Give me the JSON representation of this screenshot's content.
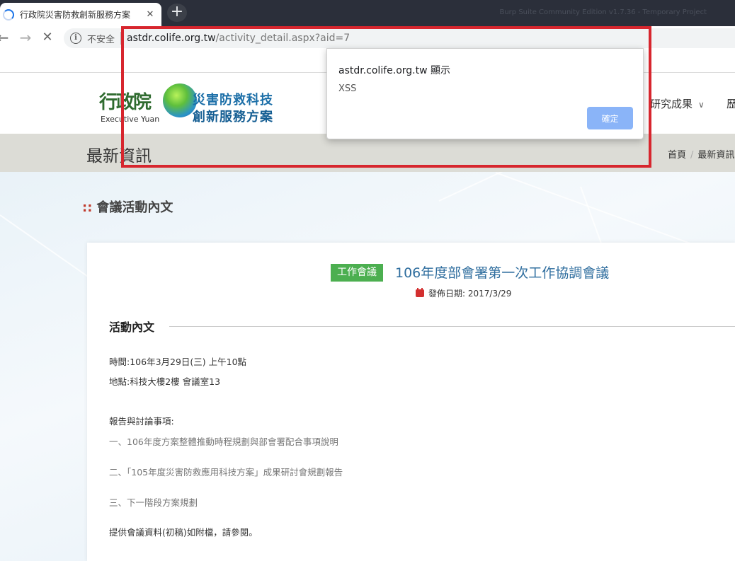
{
  "browser": {
    "tab_title": "行政院災害防救創新服務方案",
    "tab_close": "✕",
    "newtab": "+",
    "background_window_title": "Burp Suite Community Edition v1.7.36 - Temporary Project",
    "back": "←",
    "forward": "→",
    "reload": "✕",
    "info_glyph": "i",
    "insecure_label": "不安全",
    "url_host": "astdr.colife.org.tw",
    "url_path": "/activity_detail.aspx?aid=7"
  },
  "alert": {
    "title": "astdr.colife.org.tw 顯示",
    "message": "XSS",
    "ok_label": "確定"
  },
  "site": {
    "logo_yuan": "行政院",
    "logo_en": "Executive Yuan",
    "logo_line1": "災害防救科技",
    "logo_line2": "創新服務方案",
    "menu": [
      {
        "label": "研究成果",
        "chevron": "∨"
      },
      {
        "label": "歷"
      }
    ],
    "band_title": "最新資訊",
    "breadcrumb": [
      "首頁",
      "最新資訊"
    ],
    "breadcrumb_sep": "/"
  },
  "section": {
    "dots": "::",
    "title": "會議活動內文"
  },
  "article": {
    "badge": "工作會議",
    "title": "106年度部會署第一次工作協調會議",
    "date_label": "發佈日期:",
    "date": "2017/3/29",
    "subhead": "活動內文",
    "lines": [
      "時間:106年3月29日(三) 上午10點",
      "地點:科技大樓2樓 會議室13",
      "報告與討論事項:",
      "一、106年度方案整體推動時程規劃與部會署配合事項說明",
      "二、「105年度災害防救應用科技方案」成果研討會規劃報告",
      "三、下一階段方案規劃",
      "提供會議資料(初稿)如附檔，請參閱。"
    ]
  },
  "colors": {
    "highlight": "#d7262e",
    "badge": "#4caf50",
    "title_blue": "#2e6d9e",
    "ok_button": "#8ab4f8"
  }
}
